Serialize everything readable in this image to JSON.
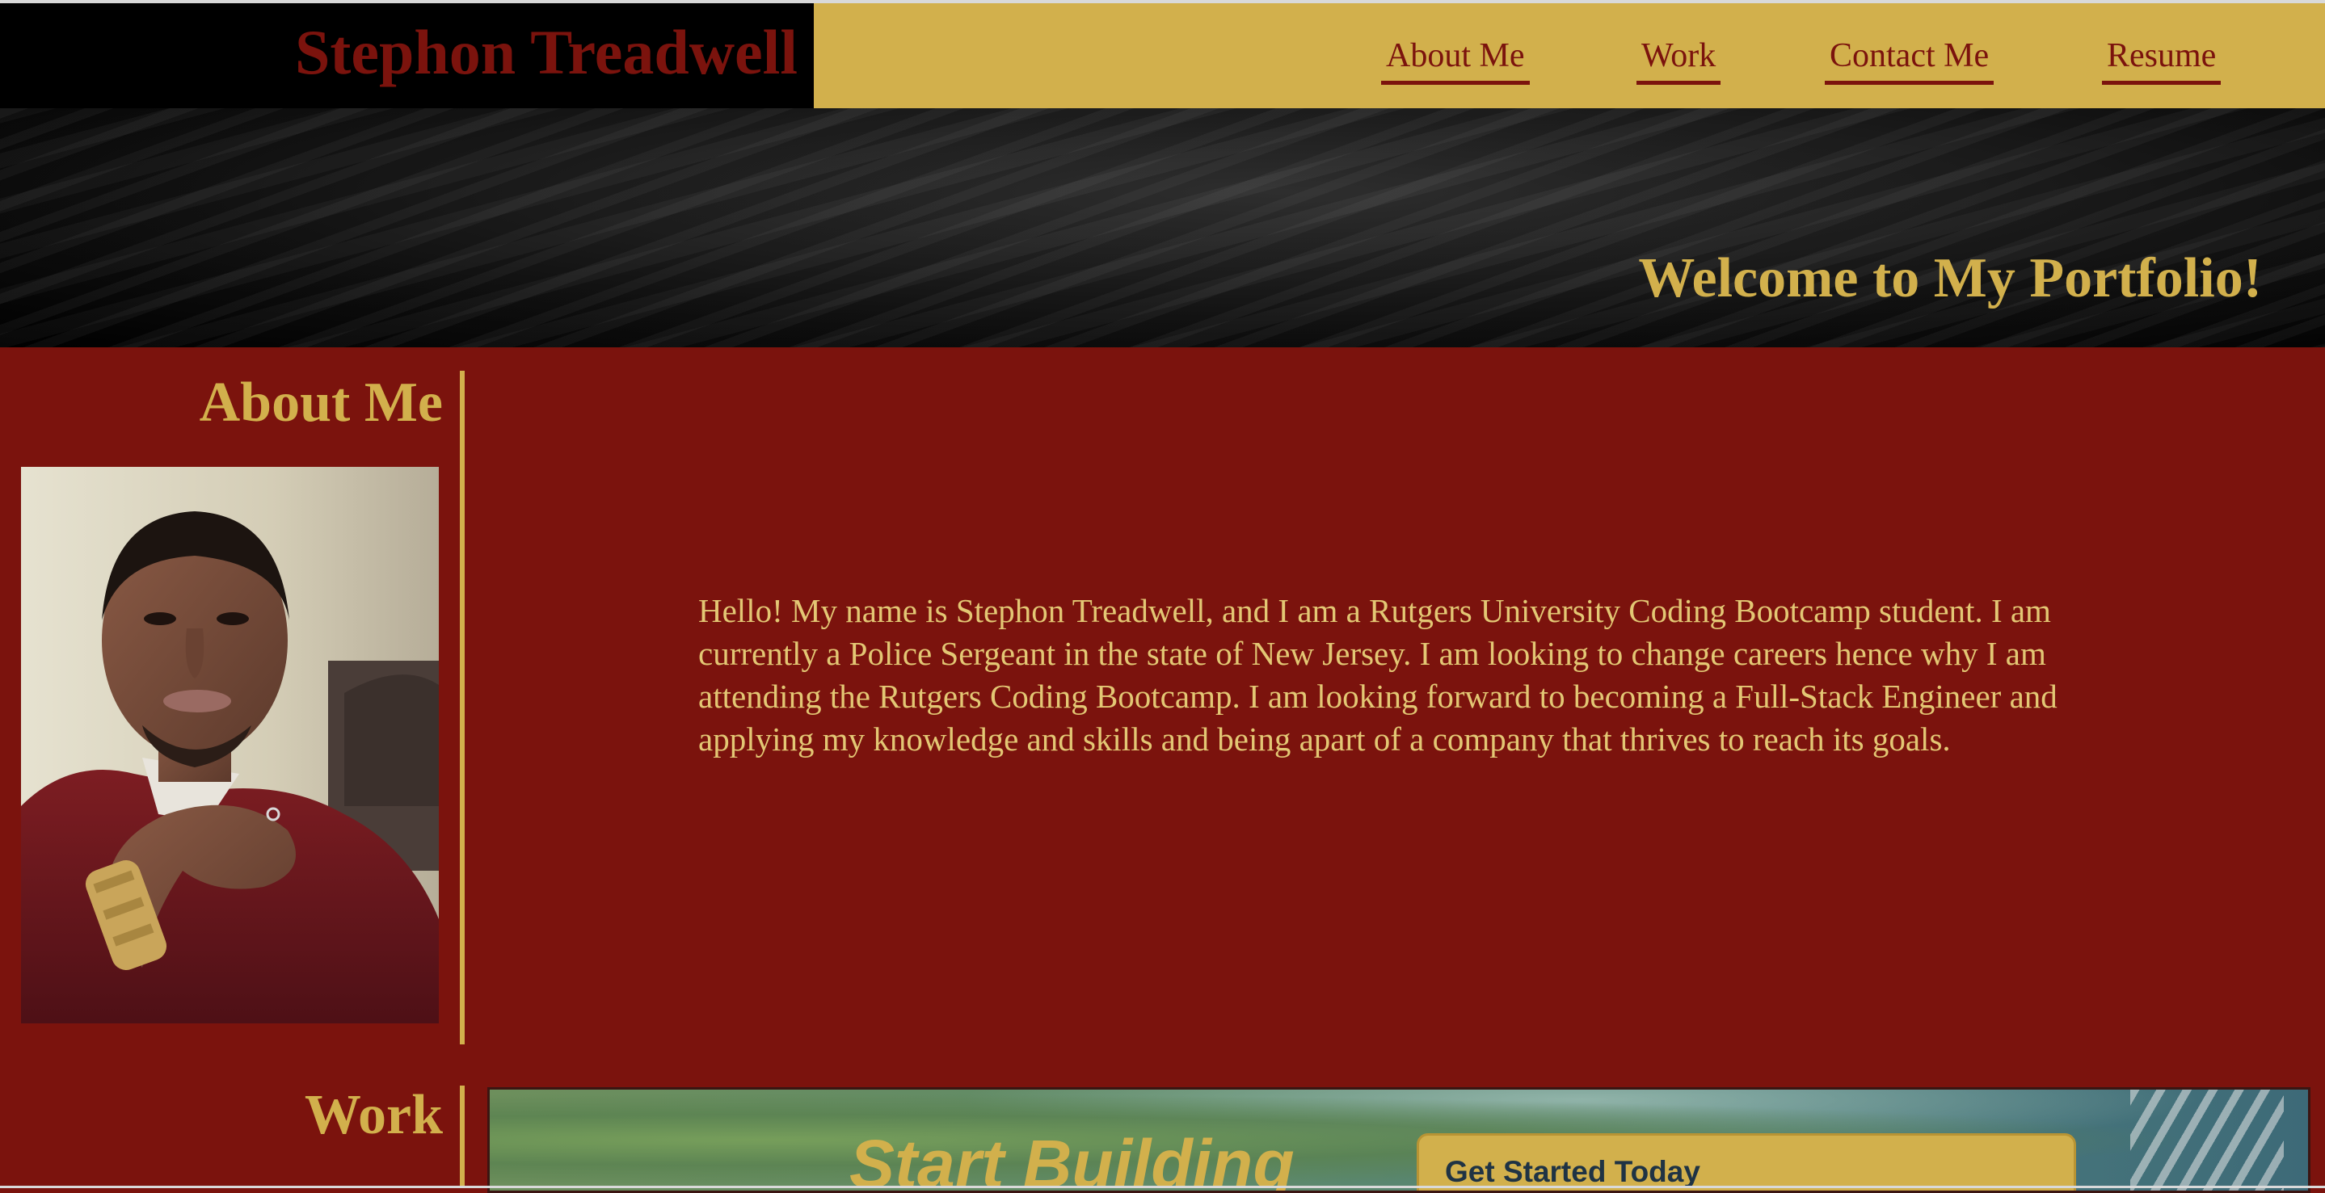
{
  "header": {
    "brand": "Stephon Treadwell",
    "nav": [
      {
        "label": "About Me"
      },
      {
        "label": "Work"
      },
      {
        "label": "Contact Me"
      },
      {
        "label": "Resume"
      }
    ]
  },
  "hero": {
    "title": "Welcome to My Portfolio!"
  },
  "about": {
    "heading": "About Me",
    "bio": "Hello! My name is Stephon Treadwell, and I am a Rutgers University Coding Bootcamp student. I am currently a Police Sergeant in the state of New Jersey. I am looking to change careers hence why I am attending the Rutgers Coding Bootcamp. I am looking forward to becoming a Full-Stack Engineer and applying my knowledge and skills and being apart of a company that thrives to reach its goals."
  },
  "work": {
    "heading": "Work",
    "project_banner": "Start Building",
    "project_cta": "Get Started Today"
  },
  "colors": {
    "maroon": "#7b130d",
    "gold": "#d2b04c",
    "black": "#000000"
  }
}
